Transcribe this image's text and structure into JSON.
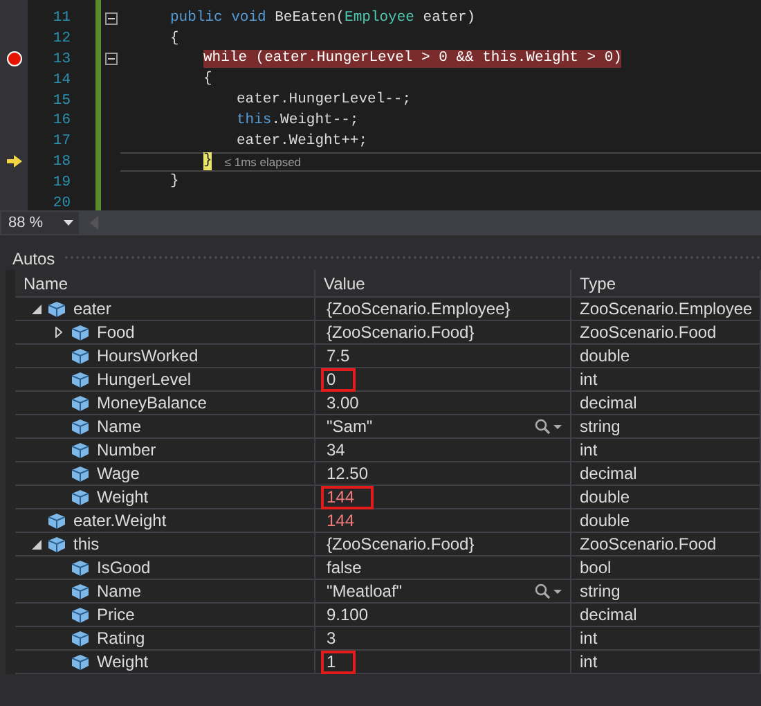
{
  "editor": {
    "lines": [
      {
        "number": "11",
        "fold": true,
        "breakpoint": false,
        "current": false,
        "tokens": [
          {
            "kind": "keyword",
            "text": "public"
          },
          {
            "kind": "keyword",
            "text": " void"
          },
          {
            "kind": "plain",
            "text": " BeEaten("
          },
          {
            "kind": "type",
            "text": "Employee"
          },
          {
            "kind": "plain",
            "text": " eater)"
          }
        ]
      },
      {
        "number": "12",
        "fold": false,
        "breakpoint": false,
        "current": false,
        "tokens": [
          {
            "kind": "plain",
            "text": "{"
          }
        ],
        "children": [
          {
            "number": "13",
            "fold": true,
            "breakpoint": true,
            "current": false,
            "tokens": [
              {
                "kind": "plain",
                "text": "while (eater.HungerLevel > 0 && this.Weight > 0)"
              }
            ]
          },
          {
            "number": "14",
            "fold": false,
            "breakpoint": false,
            "current": false,
            "tokens": [
              {
                "kind": "plain",
                "text": "{"
              }
            ],
            "children": [
              {
                "number": "15",
                "fold": false,
                "breakpoint": false,
                "current": false,
                "tokens": [
                  {
                    "kind": "plain",
                    "text": "eater.HungerLevel--;"
                  }
                ]
              },
              {
                "number": "16",
                "fold": false,
                "breakpoint": false,
                "current": false,
                "tokens": [
                  {
                    "kind": "keyword",
                    "text": "this"
                  },
                  {
                    "kind": "plain",
                    "text": ".Weight--;"
                  }
                ]
              },
              {
                "number": "17",
                "fold": false,
                "breakpoint": false,
                "current": false,
                "tokens": [
                  {
                    "kind": "plain",
                    "text": "eater.Weight++;"
                  }
                ]
              }
            ]
          },
          {
            "number": "18",
            "fold": false,
            "breakpoint": false,
            "current": true,
            "hint": "≤ 1ms elapsed",
            "tokens": [
              {
                "kind": "plain",
                "text": "}"
              }
            ]
          }
        ]
      },
      {
        "number": "19",
        "fold": false,
        "breakpoint": false,
        "current": false,
        "tokens": [
          {
            "kind": "plain",
            "text": "}"
          }
        ]
      },
      {
        "number": "20",
        "fold": false,
        "breakpoint": false,
        "current": false
      }
    ],
    "zoom": "88 %"
  },
  "autos": {
    "title": "Autos",
    "columns": [
      "Name",
      "Value",
      "Type"
    ],
    "rows": [
      {
        "name": "eater",
        "value": "{ZooScenario.Employee}",
        "type": "ZooScenario.Employee",
        "expanded": true,
        "changed": false,
        "highlighted": false,
        "visualizer": false,
        "children": [
          {
            "name": "Food",
            "value": "{ZooScenario.Food}",
            "type": "ZooScenario.Food",
            "expanded": false,
            "changed": false,
            "highlighted": false,
            "visualizer": false
          },
          {
            "name": "HoursWorked",
            "value": "7.5",
            "type": "double",
            "changed": false,
            "highlighted": false,
            "visualizer": false
          },
          {
            "name": "HungerLevel",
            "value": "0",
            "type": "int",
            "changed": false,
            "highlighted": true,
            "visualizer": false
          },
          {
            "name": "MoneyBalance",
            "value": "3.00",
            "type": "decimal",
            "changed": false,
            "highlighted": false,
            "visualizer": false
          },
          {
            "name": "Name",
            "value": "\"Sam\"",
            "type": "string",
            "changed": false,
            "highlighted": false,
            "visualizer": true
          },
          {
            "name": "Number",
            "value": "34",
            "type": "int",
            "changed": false,
            "highlighted": false,
            "visualizer": false
          },
          {
            "name": "Wage",
            "value": "12.50",
            "type": "decimal",
            "changed": false,
            "highlighted": false,
            "visualizer": false
          },
          {
            "name": "Weight",
            "value": "144",
            "type": "double",
            "changed": true,
            "highlighted": true,
            "visualizer": false
          }
        ]
      },
      {
        "name": "eater.Weight",
        "value": "144",
        "type": "double",
        "changed": true,
        "highlighted": false,
        "visualizer": false
      },
      {
        "name": "this",
        "value": "{ZooScenario.Food}",
        "type": "ZooScenario.Food",
        "expanded": true,
        "changed": false,
        "highlighted": false,
        "visualizer": false,
        "children": [
          {
            "name": "IsGood",
            "value": "false",
            "type": "bool",
            "changed": false,
            "highlighted": false,
            "visualizer": false
          },
          {
            "name": "Name",
            "value": "\"Meatloaf\"",
            "type": "string",
            "changed": false,
            "highlighted": false,
            "visualizer": true
          },
          {
            "name": "Price",
            "value": "9.100",
            "type": "decimal",
            "changed": false,
            "highlighted": false,
            "visualizer": false
          },
          {
            "name": "Rating",
            "value": "3",
            "type": "int",
            "changed": false,
            "highlighted": false,
            "visualizer": false
          },
          {
            "name": "Weight",
            "value": "1",
            "type": "int",
            "changed": false,
            "highlighted": true,
            "visualizer": false
          }
        ]
      }
    ]
  }
}
